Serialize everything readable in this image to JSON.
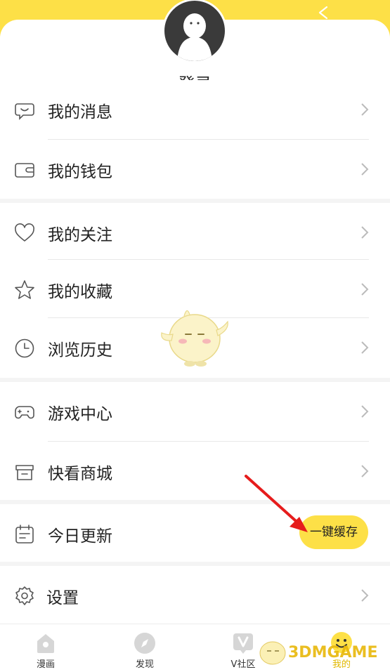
{
  "header": {
    "login_label": "登录"
  },
  "menu": {
    "messages": "我的消息",
    "wallet": "我的钱包",
    "follows": "我的关注",
    "favorites": "我的收藏",
    "history": "浏览历史",
    "game_center": "游戏中心",
    "store": "快看商城",
    "today_update": "今日更新",
    "settings": "设置"
  },
  "today_update_action": "一键缓存",
  "tabbar": {
    "comics": "漫画",
    "discover": "发现",
    "community": "V社区",
    "mine": "我的"
  },
  "watermark": "3DMGAME",
  "colors": {
    "accent": "#fde047",
    "arrow": "#e61c1c",
    "text": "#222222",
    "icon": "#555555"
  }
}
